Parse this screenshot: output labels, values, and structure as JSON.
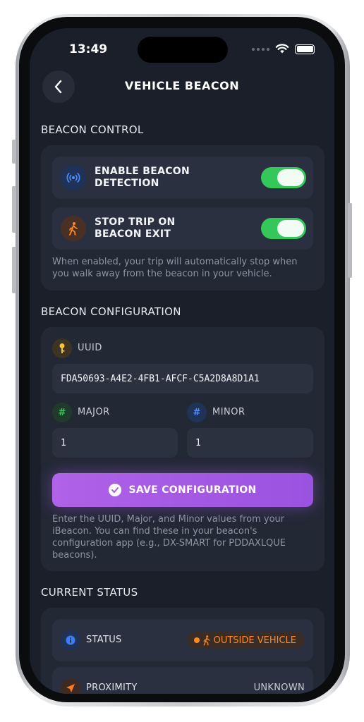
{
  "status_bar": {
    "time": "13:49"
  },
  "header": {
    "title": "VEHICLE BEACON"
  },
  "beacon_control": {
    "section_title": "BEACON CONTROL",
    "enable_detection": {
      "label_line1": "ENABLE BEACON",
      "label_line2": "DETECTION",
      "enabled": true,
      "icon": "broadcast-icon"
    },
    "stop_trip": {
      "label_line1": "STOP TRIP ON",
      "label_line2": "BEACON EXIT",
      "enabled": true,
      "icon": "walking-icon"
    },
    "help_line1": "When enabled, your trip will automatically stop when",
    "help_line2": "you walk away from the beacon in your vehicle."
  },
  "beacon_configuration": {
    "section_title": "BEACON CONFIGURATION",
    "uuid_label": "UUID",
    "uuid_value": "FDA50693-A4E2-4FB1-AFCF-C5A2D8A8D1A1",
    "major_label": "MAJOR",
    "major_value": "1",
    "minor_label": "MINOR",
    "minor_value": "1",
    "save_label": "SAVE CONFIGURATION",
    "help_line1": "Enter the UUID, Major, and Minor values from your",
    "help_line2": "iBeacon. You can find these in your beacon's",
    "help_line3": "configuration app (e.g., DX-SMART for PDDAXLQUE",
    "help_line4": "beacons)."
  },
  "current_status": {
    "section_title": "CURRENT STATUS",
    "status_label": "STATUS",
    "status_value": "OUTSIDE VEHICLE",
    "proximity_label": "PROXIMITY",
    "proximity_value": "UNKNOWN"
  },
  "colors": {
    "accent_purple": "#a75be6",
    "toggle_green": "#34c759",
    "status_orange": "#ff8a1f"
  }
}
